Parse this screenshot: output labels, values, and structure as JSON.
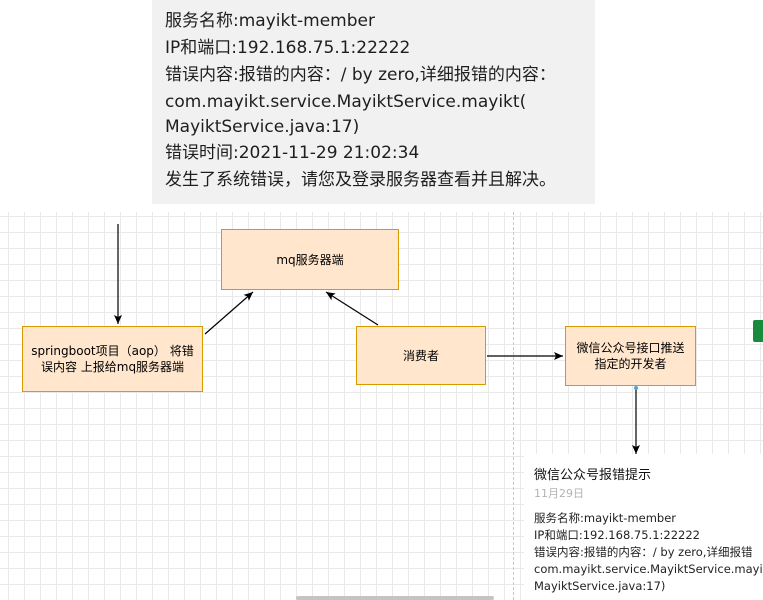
{
  "message": {
    "lines": [
      "服务名称:mayikt-member",
      "IP和端口:192.168.75.1:22222",
      "错误内容:报错的内容：/ by zero,详细报错的内容：",
      "com.mayikt.service.MayiktService.mayikt(",
      "MayiktService.java:17)",
      "错误时间:2021-11-29 21:02:34",
      "发生了系统错误，请您及登录服务器查看并且解决。"
    ]
  },
  "diagram": {
    "nodes": {
      "mq": "mq服务器端",
      "springboot": "springboot项目（aop） 将错误内容 上报给mq服务器端",
      "consumer": "消费者",
      "wechat": "微信公众号接口推送指定的开发者"
    },
    "colors": {
      "node_fill": "#ffe6cc",
      "node_stroke": "#d79b00",
      "edge": "#000000"
    }
  },
  "notification": {
    "title": "微信公众号报错提示",
    "date": "11月29日",
    "lines": [
      "服务名称:mayikt-member",
      "IP和端口:192.168.75.1:22222",
      "错误内容:报错的内容：/ by zero,详细报错",
      "com.mayikt.service.MayiktService.mayi",
      "MayiktService.java:17)"
    ]
  }
}
